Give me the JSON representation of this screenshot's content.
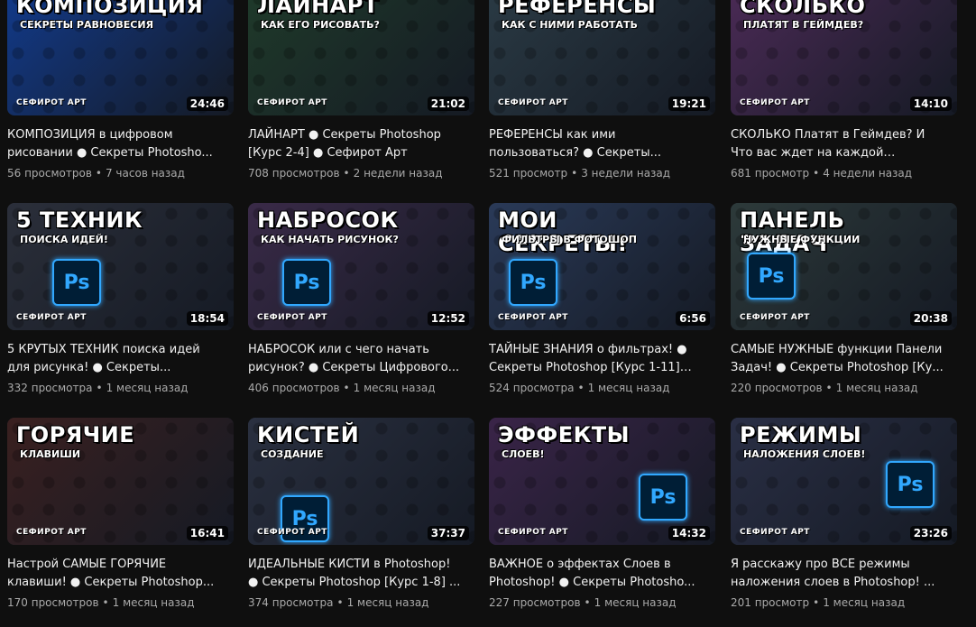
{
  "videos": [
    {
      "title": "КОМПОЗИЦИЯ в цифровом рисовании ● Секреты Photosho...",
      "views": "56 просмотров",
      "age": "7 часов назад",
      "duration": "24:46",
      "thumb_title": "КОМПОЗИЦИЯ",
      "thumb_subtitle": "СЕКРЕТЫ РАВНОВЕСИЯ",
      "thumb_brand": "СЕФИРОТ АРТ",
      "bg": "#123a8a"
    },
    {
      "title": "ЛАЙНАРТ ● Секреты Photoshop [Курс 2-4] ● Сефирот Арт",
      "views": "708 просмотров",
      "age": "2 недели назад",
      "duration": "21:02",
      "thumb_title": "ЛАЙНАРТ",
      "thumb_subtitle": "КАК ЕГО РИСОВАТЬ?",
      "thumb_brand": "СЕФИРОТ АРТ",
      "bg": "#1f3a2a"
    },
    {
      "title": "РЕФЕРЕНСЫ как ими пользоваться? ● Секреты...",
      "views": "521 просмотр",
      "age": "3 недели назад",
      "duration": "19:21",
      "thumb_title": "РЕФЕРЕНСЫ",
      "thumb_subtitle": "КАК С НИМИ РАБОТАТЬ",
      "thumb_brand": "СЕФИРОТ АРТ",
      "bg": "#2a3a44"
    },
    {
      "title": "СКОЛЬКО Платят в Геймдев? И Что вас ждет на каждой должности ...",
      "views": "681 просмотр",
      "age": "4 недели назад",
      "duration": "14:10",
      "thumb_title": "СКОЛЬКО",
      "thumb_subtitle": "ПЛАТЯТ В ГЕЙМДЕВ?",
      "thumb_brand": "СЕФИРОТ АРТ",
      "bg": "#4a2a55"
    },
    {
      "title": "5 КРУТЫХ ТЕХНИК поиска идей для рисунка! ● Секреты...",
      "views": "332 просмотра",
      "age": "1 месяц назад",
      "duration": "18:54",
      "thumb_title": "5 ТЕХНИК",
      "thumb_subtitle": "ПОИСКА ИДЕЙ!",
      "thumb_brand": "СЕФИРОТ АРТ",
      "bg": "#2b2f3a"
    },
    {
      "title": "НАБРОСОК или с чего начать рисунок? ● Секреты Цифрового...",
      "views": "406 просмотров",
      "age": "1 месяц назад",
      "duration": "12:52",
      "thumb_title": "НАБРОСОК",
      "thumb_subtitle": "КАК НАЧАТЬ РИСУНОК?",
      "thumb_brand": "СЕФИРОТ АРТ",
      "bg": "#3a2a48"
    },
    {
      "title": "ТАЙНЫЕ ЗНАНИЯ о фильтрах! ● Секреты Photoshop [Курс 1-11] ●...",
      "views": "524 просмотра",
      "age": "1 месяц назад",
      "duration": "6:56",
      "thumb_title": "МОИ СЕКРЕТЫ!",
      "thumb_subtitle": "ФИЛЬТРЫ В ФОТОШОП",
      "thumb_brand": "СЕФИРОТ АРТ",
      "bg": "#2a3a58"
    },
    {
      "title": "САМЫЕ НУЖНЫЕ функции Панели Задач! ● Секреты Photoshop [Ку...",
      "views": "220 просмотров",
      "age": "1 месяц назад",
      "duration": "20:38",
      "thumb_title": "ПАНЕЛЬ ЗАДАЧ",
      "thumb_subtitle": "НУЖНЫЕ ФУНКЦИИ",
      "thumb_brand": "СЕФИРОТ АРТ",
      "bg": "#2d3a3a"
    },
    {
      "title": "Настрой САМЫЕ ГОРЯЧИЕ клавиши! ● Секреты Photoshop...",
      "views": "170 просмотров",
      "age": "1 месяц назад",
      "duration": "16:41",
      "thumb_title": "ГОРЯЧИЕ",
      "thumb_subtitle": "КЛАВИШИ",
      "thumb_brand": "СЕФИРОТ АРТ",
      "bg": "#3a2020"
    },
    {
      "title": "ИДЕАЛЬНЫЕ КИСТИ в Photoshop! ● Секреты Photoshop [Курс 1-8] ...",
      "views": "374 просмотра",
      "age": "1 месяц назад",
      "duration": "37:37",
      "thumb_title": "КИСТЕЙ",
      "thumb_subtitle": "СОЗДАНИЕ",
      "thumb_brand": "СЕФИРОТ АРТ",
      "bg": "#2a3040"
    },
    {
      "title": "ВАЖНОЕ о эффектах Слоев в Photoshop! ● Секреты Photosho...",
      "views": "227 просмотров",
      "age": "1 месяц назад",
      "duration": "14:32",
      "thumb_title": "ЭФФЕКТЫ",
      "thumb_subtitle": "СЛОЕВ!",
      "thumb_brand": "СЕФИРОТ АРТ",
      "bg": "#3a2448"
    },
    {
      "title": "Я расскажу про ВСЕ режимы наложения слоев в Photoshop! ...",
      "views": "201 просмотр",
      "age": "1 месяц назад",
      "duration": "23:26",
      "thumb_title": "РЕЖИМЫ",
      "thumb_subtitle": "НАЛОЖЕНИЯ СЛОЕВ!",
      "thumb_brand": "СЕФИРОТ АРТ",
      "bg": "#2a2f45"
    }
  ],
  "separator": "•",
  "ps_glyph": "Ps"
}
